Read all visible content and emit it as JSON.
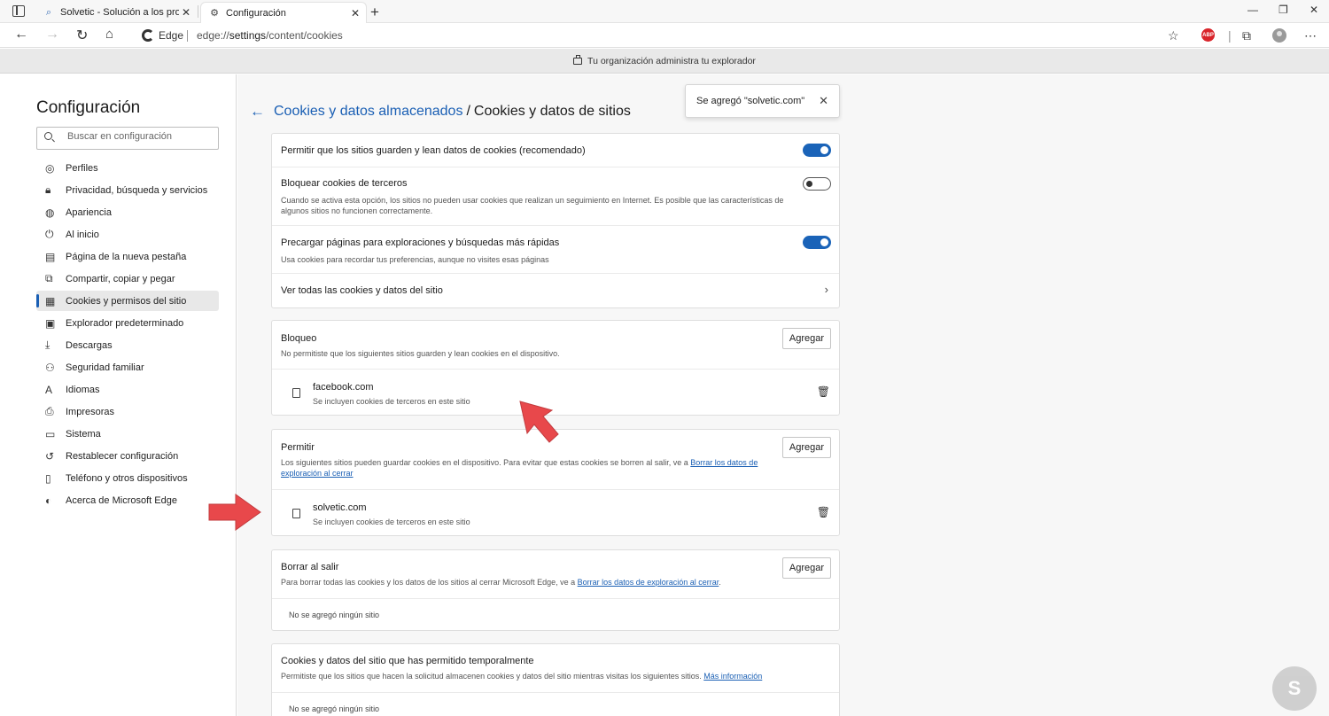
{
  "browser": {
    "tabs": [
      {
        "title": "Solvetic - Solución a los problem",
        "icon": "search-favicon"
      },
      {
        "title": "Configuración",
        "icon": "gear-icon"
      }
    ],
    "address": {
      "brand": "Edge",
      "url_prefix": "edge://",
      "url_main": "settings",
      "url_rest": "/content/cookies"
    },
    "extension_badge": "ABP",
    "managed_banner": "Tu organización administra tu explorador"
  },
  "sidebar": {
    "title": "Configuración",
    "search_placeholder": "Buscar en configuración",
    "items": [
      {
        "label": "Perfiles",
        "icon": "profile-icon"
      },
      {
        "label": "Privacidad, búsqueda y servicios",
        "icon": "lock-icon"
      },
      {
        "label": "Apariencia",
        "icon": "palette-icon"
      },
      {
        "label": "Al inicio",
        "icon": "power-icon"
      },
      {
        "label": "Página de la nueva pestaña",
        "icon": "newtab-icon"
      },
      {
        "label": "Compartir, copiar y pegar",
        "icon": "share-icon"
      },
      {
        "label": "Cookies y permisos del sitio",
        "icon": "cookie-permissions-icon",
        "active": true
      },
      {
        "label": "Explorador predeterminado",
        "icon": "browser-icon"
      },
      {
        "label": "Descargas",
        "icon": "download-icon"
      },
      {
        "label": "Seguridad familiar",
        "icon": "family-icon"
      },
      {
        "label": "Idiomas",
        "icon": "language-icon"
      },
      {
        "label": "Impresoras",
        "icon": "printer-icon"
      },
      {
        "label": "Sistema",
        "icon": "laptop-icon"
      },
      {
        "label": "Restablecer configuración",
        "icon": "reset-icon"
      },
      {
        "label": "Teléfono y otros dispositivos",
        "icon": "phone-icon"
      },
      {
        "label": "Acerca de Microsoft Edge",
        "icon": "edge-icon"
      }
    ]
  },
  "main": {
    "breadcrumb": {
      "parent": "Cookies y datos almacenados",
      "separator": "/",
      "current": "Cookies y datos de sitios"
    },
    "toast": "Se agregó \"solvetic.com\"",
    "settings": [
      {
        "title": "Permitir que los sitios guarden y lean datos de cookies (recomendado)",
        "desc": "",
        "enabled": true
      },
      {
        "title": "Bloquear cookies de terceros",
        "desc": "Cuando se activa esta opción, los sitios no pueden usar cookies que realizan un seguimiento en Internet. Es posible que las características de algunos sitios no funcionen correctamente.",
        "enabled": false
      },
      {
        "title": "Precargar páginas para exploraciones y búsquedas más rápidas",
        "desc": "Usa cookies para recordar tus preferencias, aunque no visites esas páginas",
        "enabled": true
      },
      {
        "title": "Ver todas las cookies y datos del sitio"
      }
    ],
    "block": {
      "title": "Bloqueo",
      "desc": "No permitiste que los siguientes sitios guarden y lean cookies en el dispositivo.",
      "button": "Agregar",
      "sites": [
        {
          "name": "facebook.com",
          "sub": "Se incluyen cookies de terceros en este sitio"
        }
      ]
    },
    "allow": {
      "title": "Permitir",
      "desc": "Los siguientes sitios pueden guardar cookies en el dispositivo. Para evitar que estas cookies se borren al salir, ve a",
      "link": "Borrar los datos de exploración al cerrar",
      "button": "Agregar",
      "sites": [
        {
          "name": "solvetic.com",
          "sub": "Se incluyen cookies de terceros en este sitio"
        }
      ]
    },
    "clear_on_exit": {
      "title": "Borrar al salir",
      "desc": "Para borrar todas las cookies y los datos de los sitios al cerrar Microsoft Edge, ve a",
      "link": "Borrar los datos de exploración al cerrar",
      "link_suffix": ".",
      "button": "Agregar",
      "empty": "No se agregó ningún sitio"
    },
    "temporary": {
      "title": "Cookies y datos del sitio que has permitido temporalmente",
      "desc": "Permitiste que los sitios que hacen la solicitud almacenen cookies y datos del sitio mientras visitas los siguientes sitios.",
      "link": "Más información",
      "empty": "No se agregó ningún sitio"
    }
  },
  "colors": {
    "accent": "#1a5fb4",
    "arrow": "#e8484b"
  }
}
